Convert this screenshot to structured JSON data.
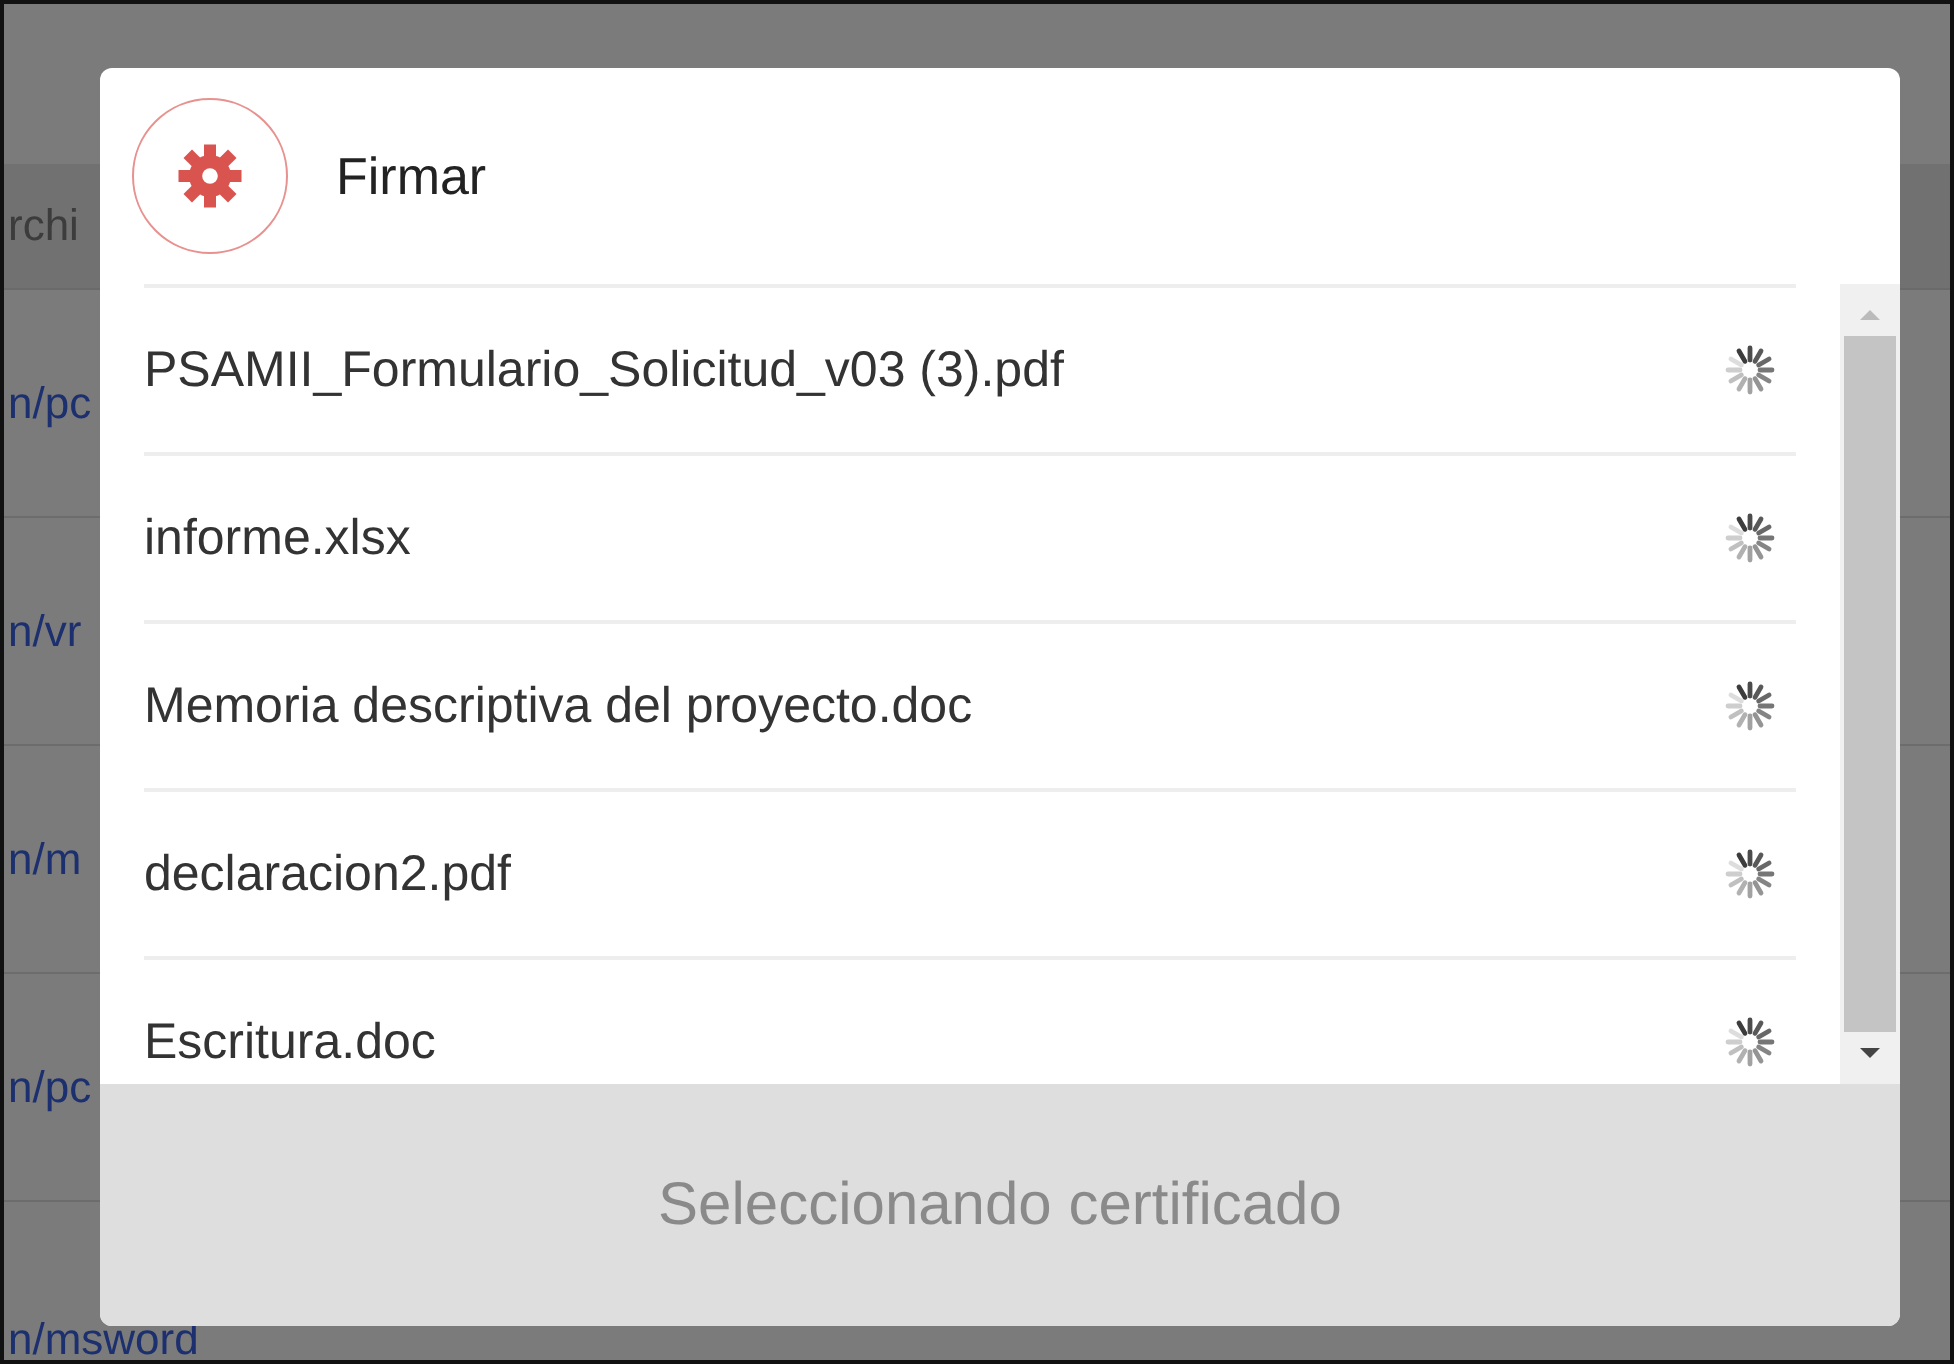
{
  "background": {
    "column_header": "rchi",
    "cells": [
      "n/pc",
      "n/vr",
      "n/m",
      "n/pc",
      "n/msword"
    ]
  },
  "dialog": {
    "title": "Firmar",
    "files": [
      {
        "name": "PSAMII_Formulario_Solicitud_v03 (3).pdf",
        "loading": true
      },
      {
        "name": "informe.xlsx",
        "loading": true
      },
      {
        "name": "Memoria descriptiva del proyecto.doc",
        "loading": true
      },
      {
        "name": "declaracion2.pdf",
        "loading": true
      },
      {
        "name": "Escritura.doc",
        "loading": true
      }
    ],
    "footer": "Seleccionando certificado"
  }
}
